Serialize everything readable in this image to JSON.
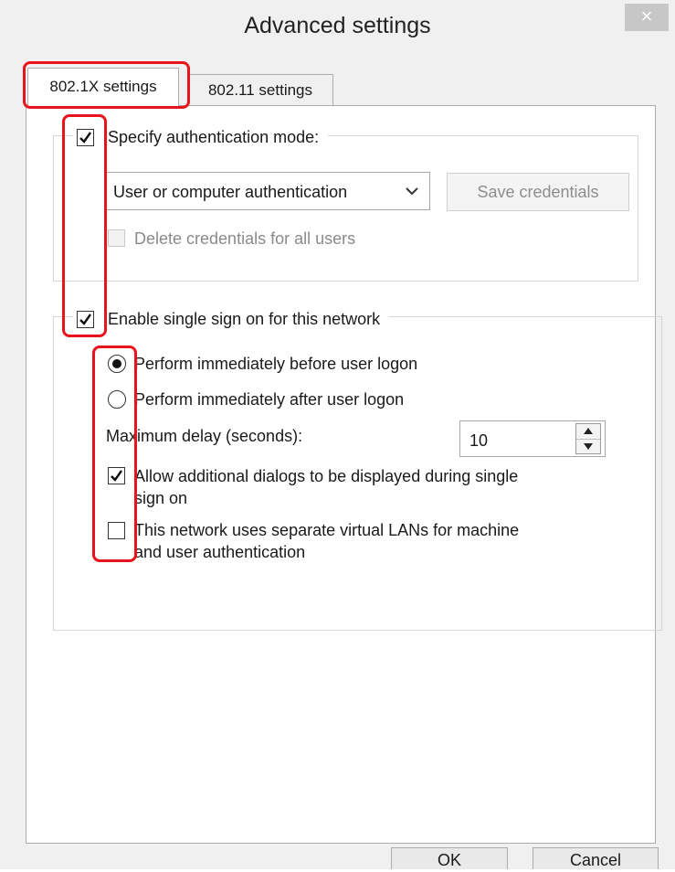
{
  "window": {
    "title": "Advanced settings",
    "close_label": "×"
  },
  "tabs": [
    {
      "label": "802.1X settings",
      "active": true
    },
    {
      "label": "802.11 settings",
      "active": false
    }
  ],
  "auth_group": {
    "specify_mode_label": "Specify authentication mode:",
    "specify_mode_checked": true,
    "mode_select_value": "User or computer authentication",
    "save_credentials_label": "Save credentials",
    "delete_credentials_label": "Delete credentials for all users",
    "delete_credentials_checked": false
  },
  "sso_group": {
    "enable_sso_label": "Enable single sign on for this network",
    "enable_sso_checked": true,
    "radio_before_label": "Perform immediately before user logon",
    "radio_after_label": "Perform immediately after user logon",
    "selected_option": "before",
    "max_delay_label": "Maximum delay (seconds):",
    "max_delay_value": "10",
    "allow_dialogs_label_line1": "Allow additional dialogs to be displayed during single",
    "allow_dialogs_label_line2": "sign on",
    "allow_dialogs_checked": true,
    "separate_vlans_label_line1": "This network uses separate virtual LANs for machine",
    "separate_vlans_label_line2": "and user authentication",
    "separate_vlans_checked": false
  },
  "footer": {
    "ok_label": "OK",
    "cancel_label": "Cancel"
  },
  "colors": {
    "highlight": "#e8131b",
    "dialog_background": "#f0f0f0",
    "panel_background": "#ffffff"
  },
  "icons": {
    "close": "close-icon",
    "checkmark": "checkmark-icon",
    "dropdown": "chevron-down-icon",
    "spin_up": "triangle-up-icon",
    "spin_down": "triangle-down-icon"
  }
}
